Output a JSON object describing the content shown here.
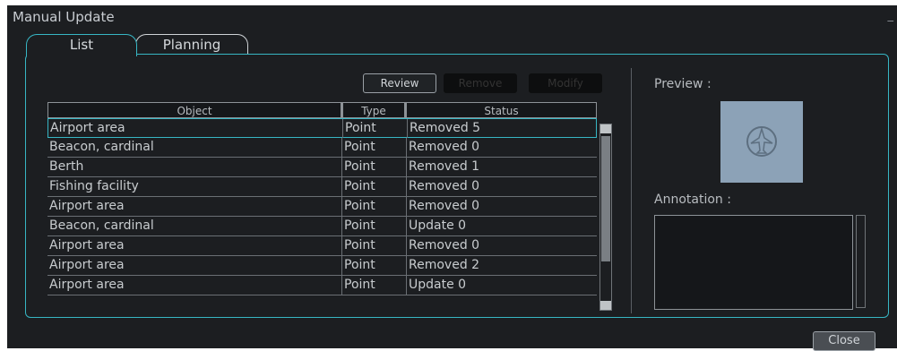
{
  "window": {
    "title": "Manual Update",
    "minimize": "_"
  },
  "tabs": [
    {
      "label": "List"
    },
    {
      "label": "Planning"
    }
  ],
  "toolbar": {
    "review": "Review",
    "remove": "Remove",
    "modify": "Modify"
  },
  "table": {
    "headers": {
      "object": "Object",
      "type": "Type",
      "status": "Status"
    },
    "rows": [
      {
        "object": "Airport area",
        "type": "Point",
        "status": "Removed 5"
      },
      {
        "object": "Beacon, cardinal",
        "type": "Point",
        "status": "Removed 0"
      },
      {
        "object": "Berth",
        "type": "Point",
        "status": "Removed 1"
      },
      {
        "object": "Fishing facility",
        "type": "Point",
        "status": "Removed 0"
      },
      {
        "object": "Airport area",
        "type": "Point",
        "status": "Removed 0"
      },
      {
        "object": "Beacon, cardinal",
        "type": "Point",
        "status": "Update 0"
      },
      {
        "object": "Airport area",
        "type": "Point",
        "status": "Removed 0"
      },
      {
        "object": "Airport area",
        "type": "Point",
        "status": "Removed 2"
      },
      {
        "object": "Airport area",
        "type": "Point",
        "status": "Update 0"
      }
    ],
    "selected_index": 0
  },
  "preview": {
    "label": "Preview :",
    "icon": "airport-symbol-icon",
    "bg_color": "#8ca2b7"
  },
  "annotation": {
    "label": "Annotation :",
    "value": ""
  },
  "footer": {
    "close": "Close"
  },
  "colors": {
    "accent": "#37b6c4",
    "background": "#1c1e21"
  }
}
